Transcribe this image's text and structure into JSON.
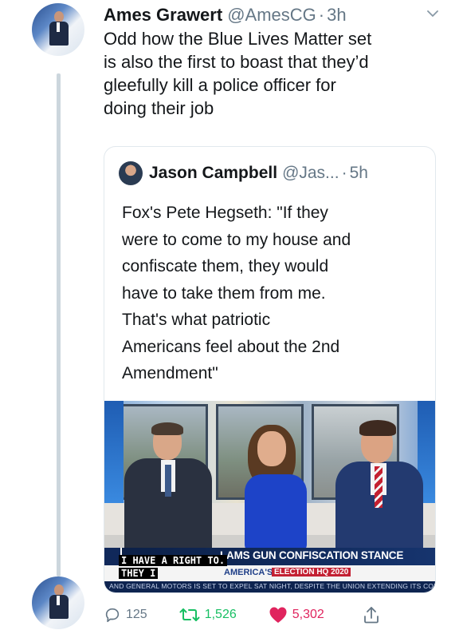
{
  "tweet": {
    "author_name": "Ames Grawert",
    "author_handle": "@AmesCG",
    "separator": "·",
    "time": "3h",
    "text": "Odd how the Blue Lives Matter set\nis also the first to boast that they’d\ngleefully kill a police officer for\ndoing their job"
  },
  "quoted_tweet": {
    "author_name": "Jason Campbell",
    "author_handle": "@Jas...",
    "separator": "·",
    "time": "5h",
    "text": "Fox's Pete Hegseth: \"If they\nwere to come to my house and\nconfiscate them, they would\nhave to take them from me.\nThat's what patriotic\nAmericans feel about the 2nd\nAmendment\"",
    "media": {
      "headline": "LAMS GUN CONFISCATION STANCE",
      "show": "AMERICA'S",
      "election_badge": "ELECTION HQ 2020",
      "ticker": "AND GENERAL MOTORS IS SET TO EXPEL SAT NIGHT, DESPITE THE UNION EXTENDING ITS CONTRACTS W",
      "caption_line1": "I HAVE A RIGHT TO.",
      "caption_line2": "THEY I"
    }
  },
  "actions": {
    "replies": "125",
    "retweets": "1,526",
    "likes": "5,302"
  },
  "colors": {
    "name": "#14171a",
    "secondary": "#657786",
    "retweet": "#17bf63",
    "like": "#e0245e",
    "thread_line": "#ccd6dd"
  },
  "icons": [
    "caret-down-icon",
    "reply-icon",
    "retweet-icon",
    "like-icon",
    "share-icon"
  ]
}
